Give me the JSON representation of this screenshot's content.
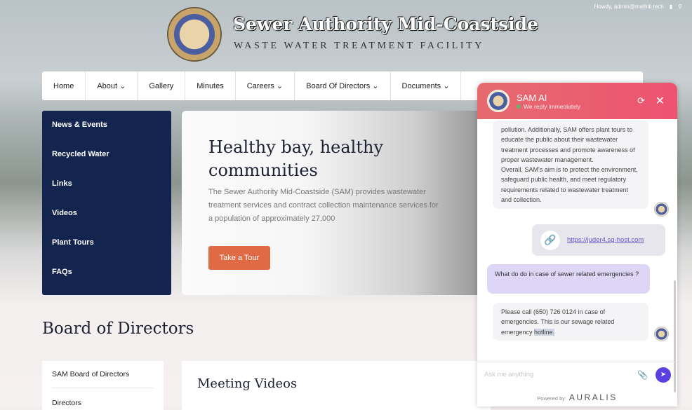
{
  "topbar": {
    "greeting": "Howdy, admin@mathiti.tech"
  },
  "site": {
    "title": "Sewer Authority Mid-Coastside",
    "subtitle": "WASTE WATER TREATMENT FACILITY"
  },
  "nav": [
    "Home",
    "About ⌄",
    "Gallery",
    "Minutes",
    "Careers ⌄",
    "Board Of Directors ⌄",
    "Documents ⌄"
  ],
  "sidebar": [
    "News & Events",
    "Recycled Water",
    "Links",
    "Videos",
    "Plant Tours",
    "FAQs"
  ],
  "hero": {
    "heading": "Healthy bay, healthy communities",
    "text": "The Sewer Authority Mid-Coastside (SAM) provides wastewater treatment services and contract collection maintenance services for a population of approximately 27,000",
    "button": "Take a Tour"
  },
  "board": {
    "heading": "Board of Directors",
    "items": [
      "SAM Board of Directors",
      "Directors"
    ],
    "videos": "Meeting Videos"
  },
  "chat": {
    "name": "SAM AI",
    "status": "We reply immediately",
    "bot1": "pollution. Additionally, SAM offers plant tours to educate the public about their wastewater treatment processes and promote awareness of proper wastewater management.\nOverall, SAM's aim is to protect the environment, safeguard public health, and meet regulatory requirements related to wastewater treatment and collection.",
    "link": "https://juder4.sg-host.com",
    "user": "What do do in case of sewer related emergencies ?",
    "bot2_a": "Please call  (650) 726 0124 in case of emergencies. This is our sewage related emergency ",
    "bot2_hl": "hotline.",
    "placeholder": "Ask me anything",
    "powered": "Powered by",
    "brand": "AURALIS"
  },
  "colors": {
    "header": "#ee5370",
    "navy": "#13244f",
    "cta": "#e06a43",
    "send": "#5b3fe0"
  }
}
